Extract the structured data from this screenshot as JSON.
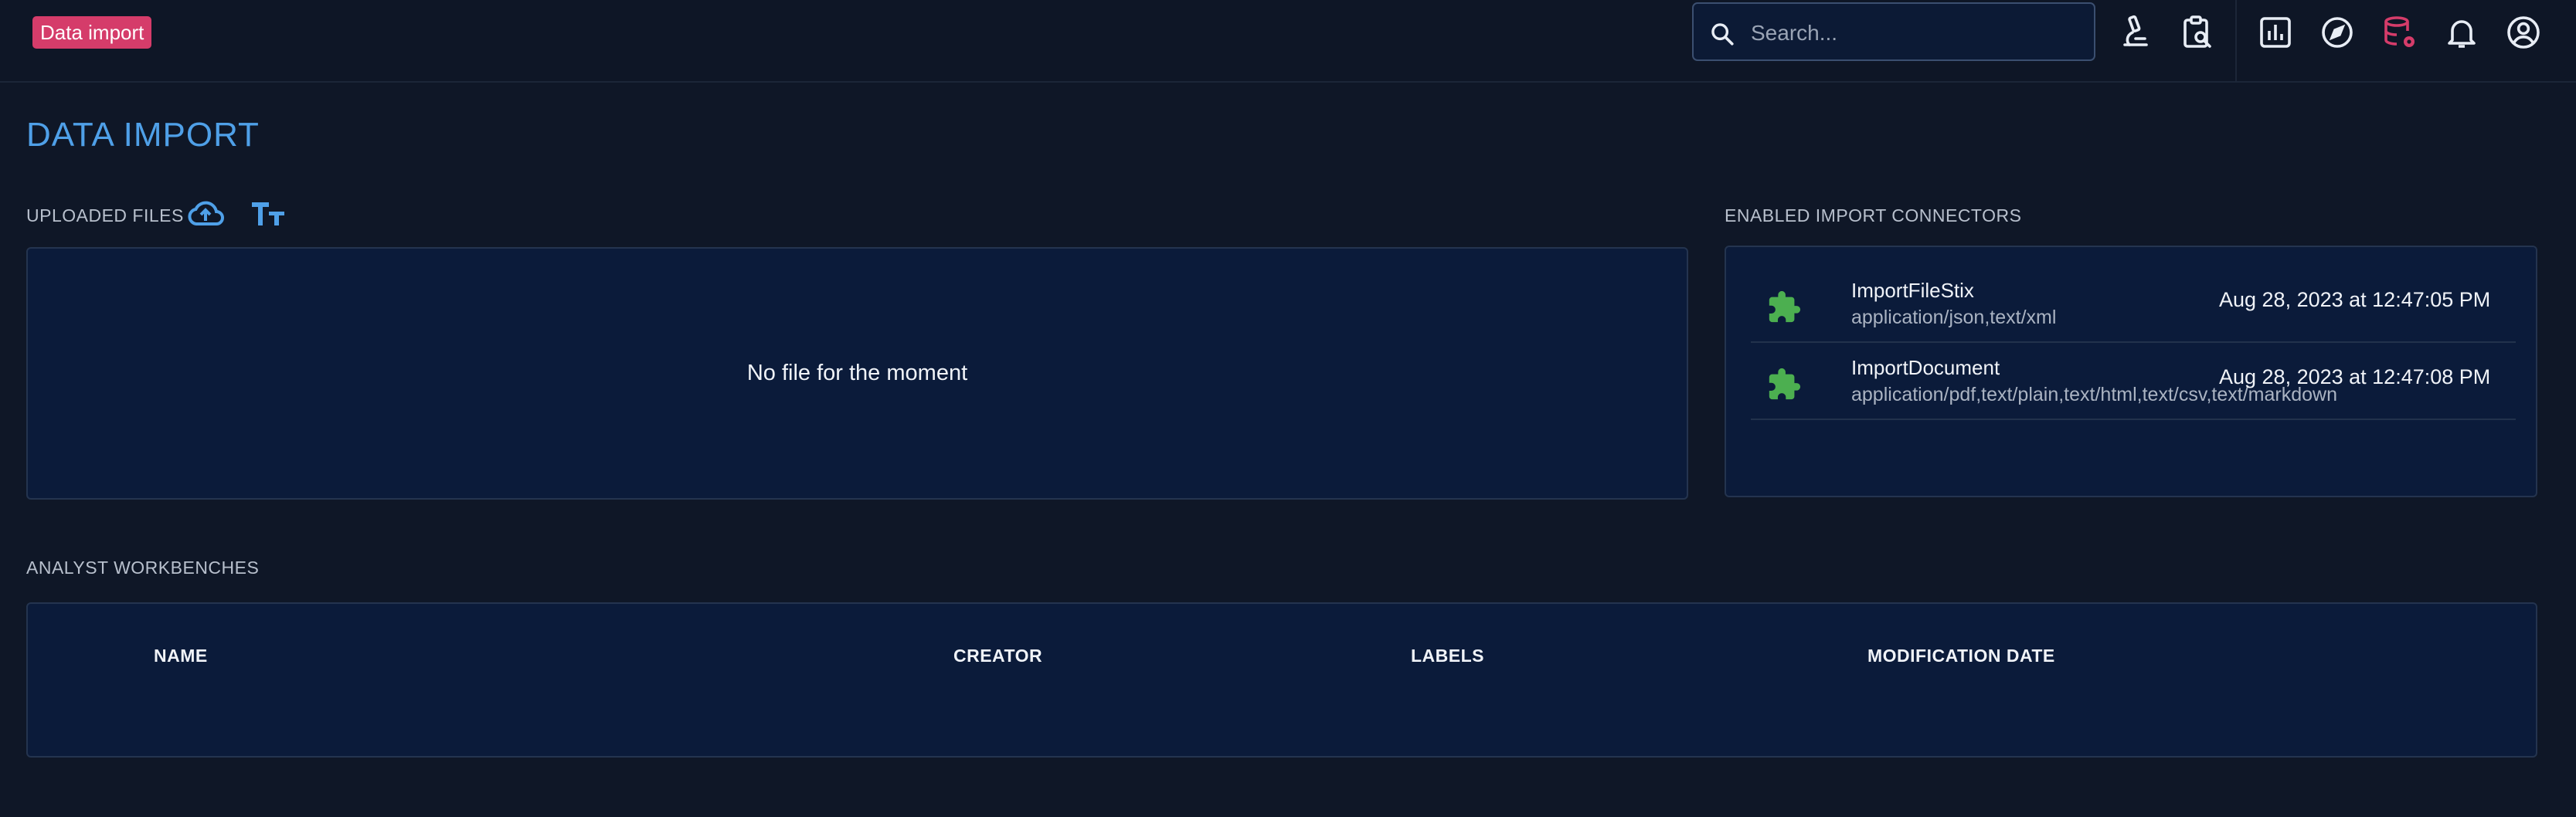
{
  "header": {
    "badge_label": "Data import",
    "search": {
      "placeholder": "Search..."
    },
    "icons": [
      "microscope-icon",
      "clipboard-search-icon",
      "chart-icon",
      "compass-icon",
      "database-cog-icon",
      "bell-icon",
      "account-icon"
    ],
    "colors": {
      "accent": "#d53c6a",
      "primary": "#4fa0e8",
      "connector": "#4caf50"
    }
  },
  "main": {
    "title": "DATA IMPORT",
    "uploaded_files": {
      "label": "UPLOADED FILES",
      "empty_message": "No file for the moment"
    },
    "connectors": {
      "label": "ENABLED IMPORT CONNECTORS",
      "items": [
        {
          "name": "ImportFileStix",
          "types": "application/json,text/xml",
          "date": "Aug 28, 2023 at 12:47:05 PM"
        },
        {
          "name": "ImportDocument",
          "types": "application/pdf,text/plain,text/html,text/csv,text/markdown",
          "date": "Aug 28, 2023 at 12:47:08 PM"
        }
      ]
    },
    "workbenches": {
      "label": "ANALYST WORKBENCHES",
      "columns": [
        "NAME",
        "CREATOR",
        "LABELS",
        "MODIFICATION DATE"
      ]
    }
  }
}
